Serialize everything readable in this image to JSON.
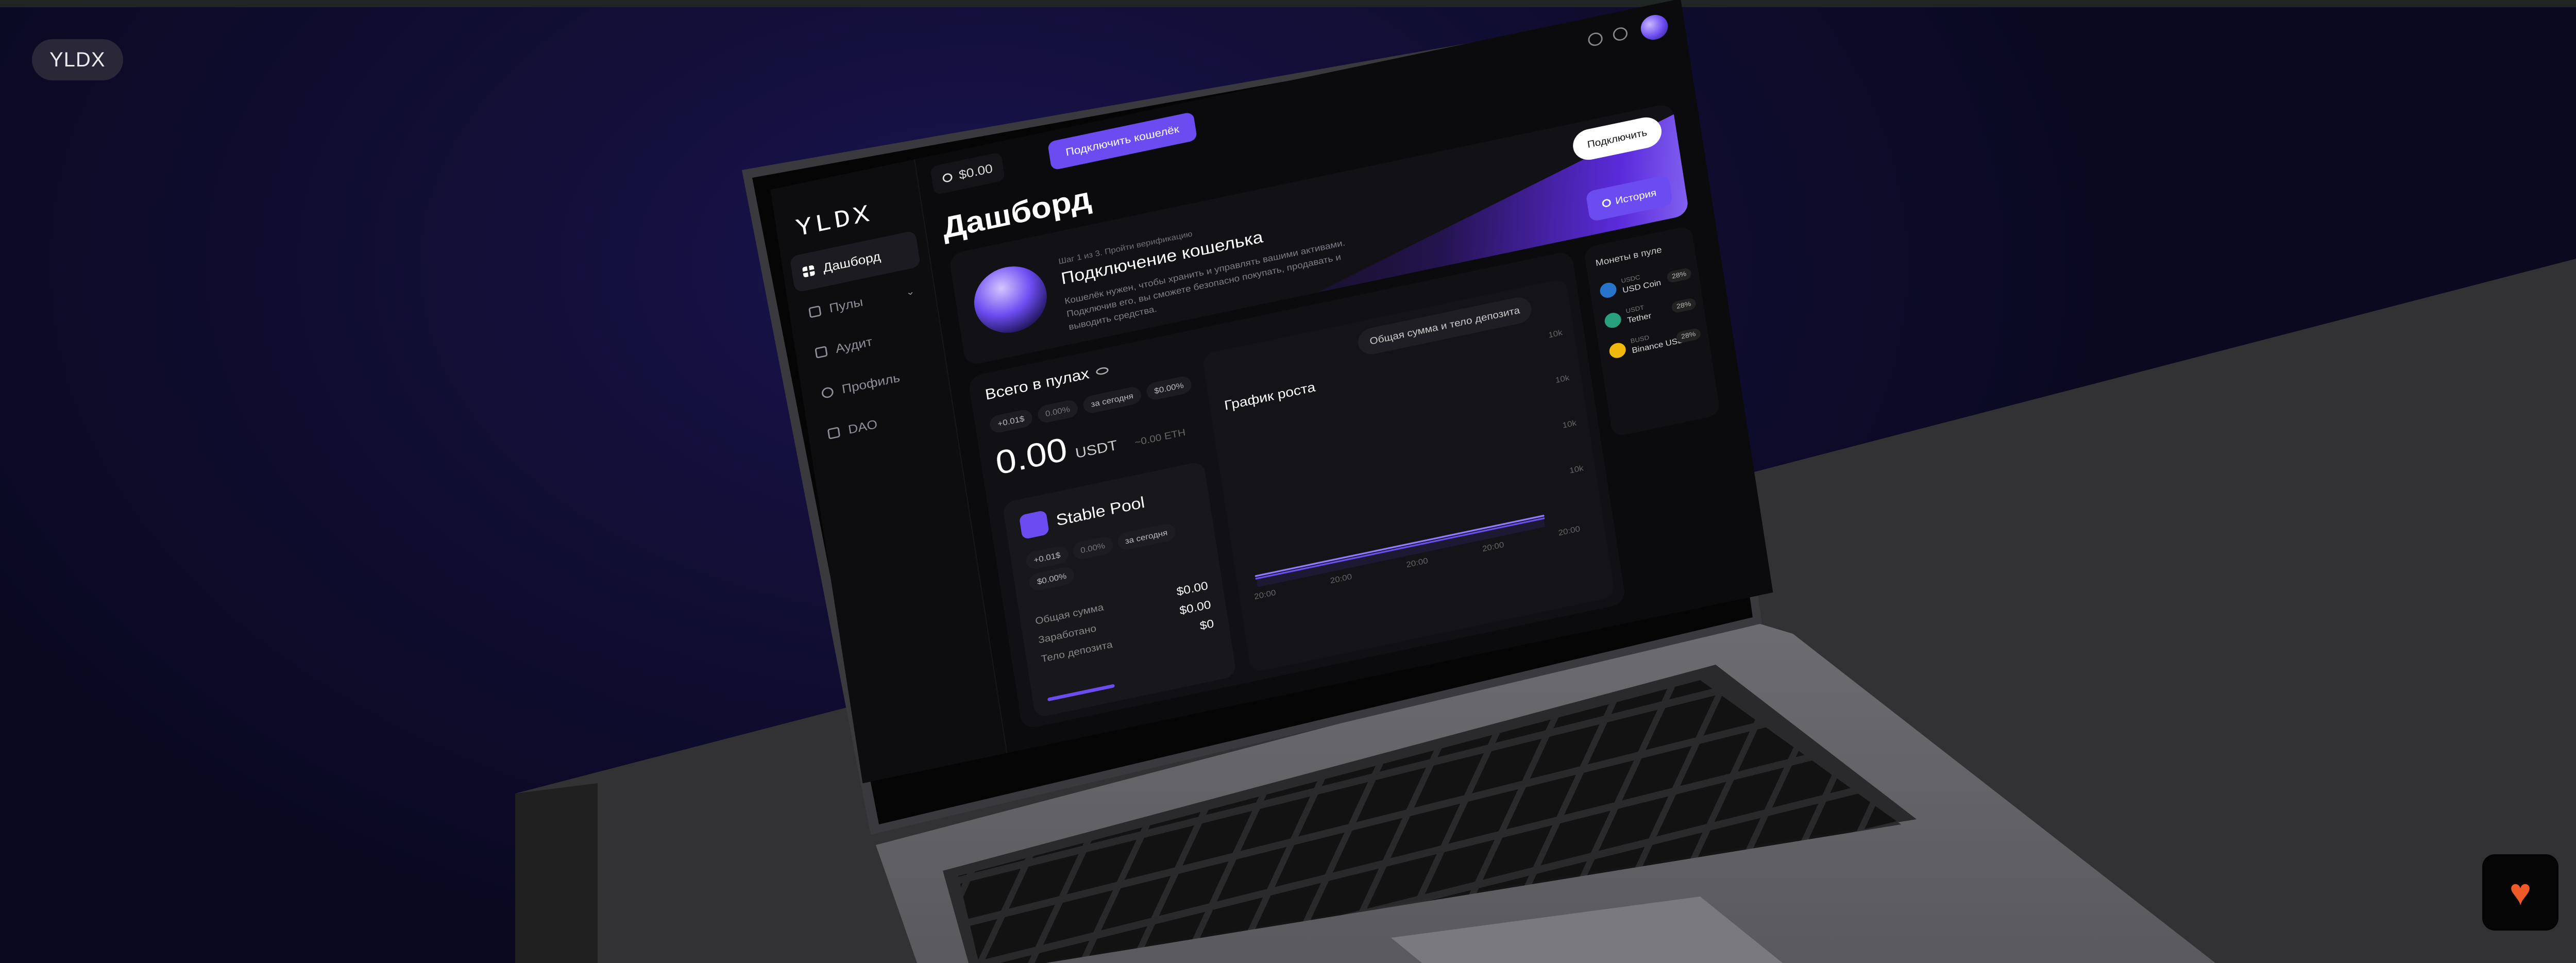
{
  "brand": {
    "label": "YLDX"
  },
  "sidebar": {
    "logo": "YLDX",
    "items": [
      {
        "label": "Дашборд",
        "icon": "grid-icon",
        "active": true
      },
      {
        "label": "Пулы",
        "icon": "layers-icon"
      },
      {
        "label": "Аудит",
        "icon": "audit-icon"
      },
      {
        "label": "Профиль",
        "icon": "user-icon"
      },
      {
        "label": "DAO",
        "icon": "doc-icon"
      }
    ]
  },
  "topbar": {
    "balance": "$0.00",
    "connect_label": "Подключить кошелёк"
  },
  "page": {
    "title": "Дашборд"
  },
  "wallet": {
    "step": "Шаг 1 из 3. Пройти верификацию",
    "title": "Подключение кошелька",
    "description": "Кошелёк нужен, чтобы хранить и управлять вашими активами. Подключив его, вы сможете безопасно покупать, продавать и выводить средства.",
    "connect_label": "Подключить",
    "history_label": "История"
  },
  "pools": {
    "title": "Всего в пулах",
    "chips": [
      "+0.01$",
      "0.00%",
      "за сегодня",
      "$0.00%"
    ],
    "value": "0.00",
    "currency": "USDT",
    "eth": "~0.00 ETH"
  },
  "stable_pool": {
    "title": "Stable Pool",
    "chips": [
      "+0.01$",
      "0.00%",
      "за сегодня",
      "$0.00%"
    ],
    "rows": [
      {
        "label": "Общая сумма",
        "value": "$0.00"
      },
      {
        "label": "Заработано",
        "value": "$0.00"
      },
      {
        "label": "Тело депозита",
        "value": "$0"
      }
    ]
  },
  "growth": {
    "title": "График роста",
    "select": "Общая сумма и тело депозита",
    "yticks": [
      "10k",
      "10k",
      "10k",
      "10k"
    ],
    "xticks": [
      "20:00",
      "20:00",
      "20:00",
      "20:00",
      "20:00"
    ]
  },
  "chart_data": {
    "type": "line",
    "title": "График роста",
    "x": [
      "20:00",
      "20:00",
      "20:00",
      "20:00",
      "20:00"
    ],
    "series": [
      {
        "name": "Общая сумма",
        "values": [
          0,
          0,
          0,
          0,
          0
        ]
      },
      {
        "name": "Тело депозита",
        "values": [
          0,
          0,
          0,
          0,
          0
        ]
      }
    ],
    "ylabel": "",
    "xlabel": ""
  },
  "coins": {
    "title": "Монеты в пуле",
    "items": [
      {
        "ticker": "USDC",
        "name": "USD Coin",
        "pct": "28%",
        "color": "#2775ca"
      },
      {
        "ticker": "USDT",
        "name": "Tether",
        "pct": "28%",
        "color": "#26a17b"
      },
      {
        "ticker": "BUSD",
        "name": "Binance USD",
        "pct": "28%",
        "color": "#f0b90b"
      }
    ]
  },
  "colors": {
    "accent": "#6b4cf0",
    "heart": "#f05a28"
  },
  "fab": {
    "icon": "heart-icon"
  }
}
